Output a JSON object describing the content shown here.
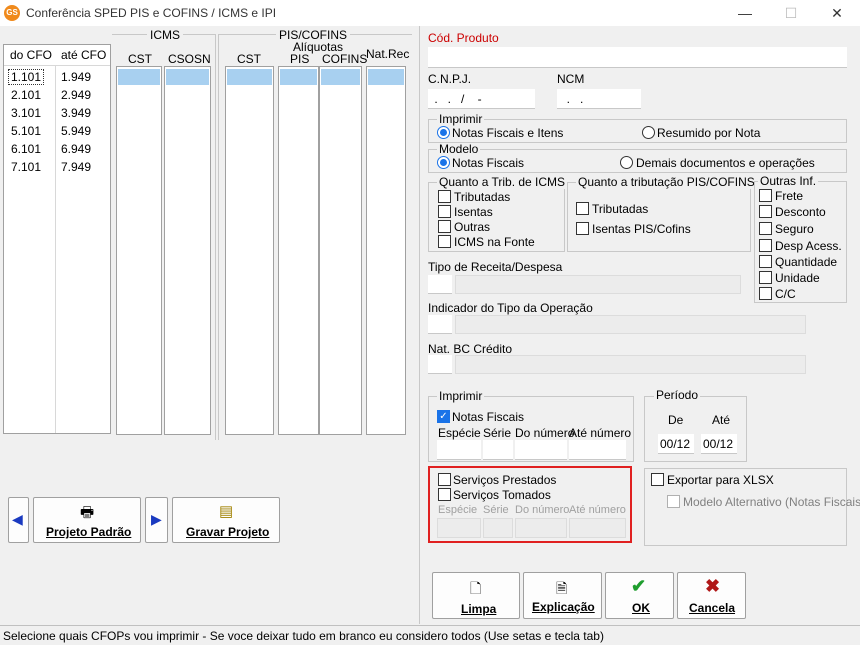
{
  "window": {
    "title": "Conferência SPED PIS e COFINS / ICMS e IPI",
    "icon_label": "GS"
  },
  "cfo_table": {
    "headers": {
      "from": "do CFO",
      "to": "até CFO"
    },
    "rows": [
      {
        "from": "1.101",
        "to": "1.949"
      },
      {
        "from": "2.101",
        "to": "2.949"
      },
      {
        "from": "3.101",
        "to": "3.949"
      },
      {
        "from": "5.101",
        "to": "5.949"
      },
      {
        "from": "6.101",
        "to": "6.949"
      },
      {
        "from": "7.101",
        "to": "7.949"
      }
    ]
  },
  "icms_table": {
    "group": "ICMS",
    "cols": [
      "CST",
      "CSOSN"
    ]
  },
  "piscofins_table": {
    "group": "PIS/COFINS",
    "sub": "Alíquotas",
    "cols": [
      "CST",
      "PIS",
      "COFINS",
      "Nat.Rec"
    ]
  },
  "left_buttons": {
    "projeto_padrao": "Projeto Padrão",
    "gravar_projeto": "Gravar Projeto"
  },
  "right": {
    "cod_produto": "Cód. Produto",
    "cnpj_label": "C.N.P.J.",
    "cnpj_value": " .   .   /    -",
    "ncm_label": "NCM",
    "ncm_value": "  .   .",
    "imprimir_title": "Imprimir",
    "imprimir_opt1": "Notas Fiscais e Itens",
    "imprimir_opt2": "Resumido por Nota",
    "modelo_title": "Modelo",
    "modelo_opt1": "Notas Fiscais",
    "modelo_opt2": "Demais documentos e operações",
    "trib_icms_title": "Quanto a Trib. de ICMS",
    "trib_icms": [
      "Tributadas",
      "Isentas",
      "Outras",
      "ICMS na Fonte"
    ],
    "trib_pis_title": "Quanto a tributação PIS/COFINS",
    "trib_pis": [
      "Tributadas",
      "Isentas PIS/Cofins"
    ],
    "outras_title": "Outras Inf.",
    "outras": [
      "Frete",
      "Desconto",
      "Seguro",
      "Desp Acess.",
      "Quantidade",
      "Unidade",
      "C/C"
    ],
    "tipo_receita": "Tipo de Receita/Despesa",
    "indicador": "Indicador do Tipo da Operação",
    "nat_bc": "Nat. BC Crédito",
    "imprimir2_title": "Imprimir",
    "notas_fiscais": "Notas Fiscais",
    "cols": [
      "Espécie",
      "Série",
      "Do número",
      "Até número"
    ],
    "servicos_prestados": "Serviços Prestados",
    "servicos_tomados": "Serviços Tomados",
    "periodo_title": "Período",
    "de_label": "De",
    "ate_label": "Até",
    "de_value": "00/12",
    "ate_value": "00/12",
    "exportar": "Exportar para XLSX",
    "modelo_alt": "Modelo Alternativo (Notas Fiscais)"
  },
  "bottom_buttons": {
    "limpa": "Limpa",
    "explicacao": "Explicação",
    "ok": "OK",
    "cancela": "Cancela"
  },
  "status": "Selecione quais CFOPs vou imprimir - Se voce deixar tudo em branco eu considero todos (Use setas e tecla tab)",
  "colors": {
    "highlight": "#e02020",
    "selection": "#a8d0f0",
    "accent": "#1a73e8",
    "label_red": "#cc0000"
  }
}
